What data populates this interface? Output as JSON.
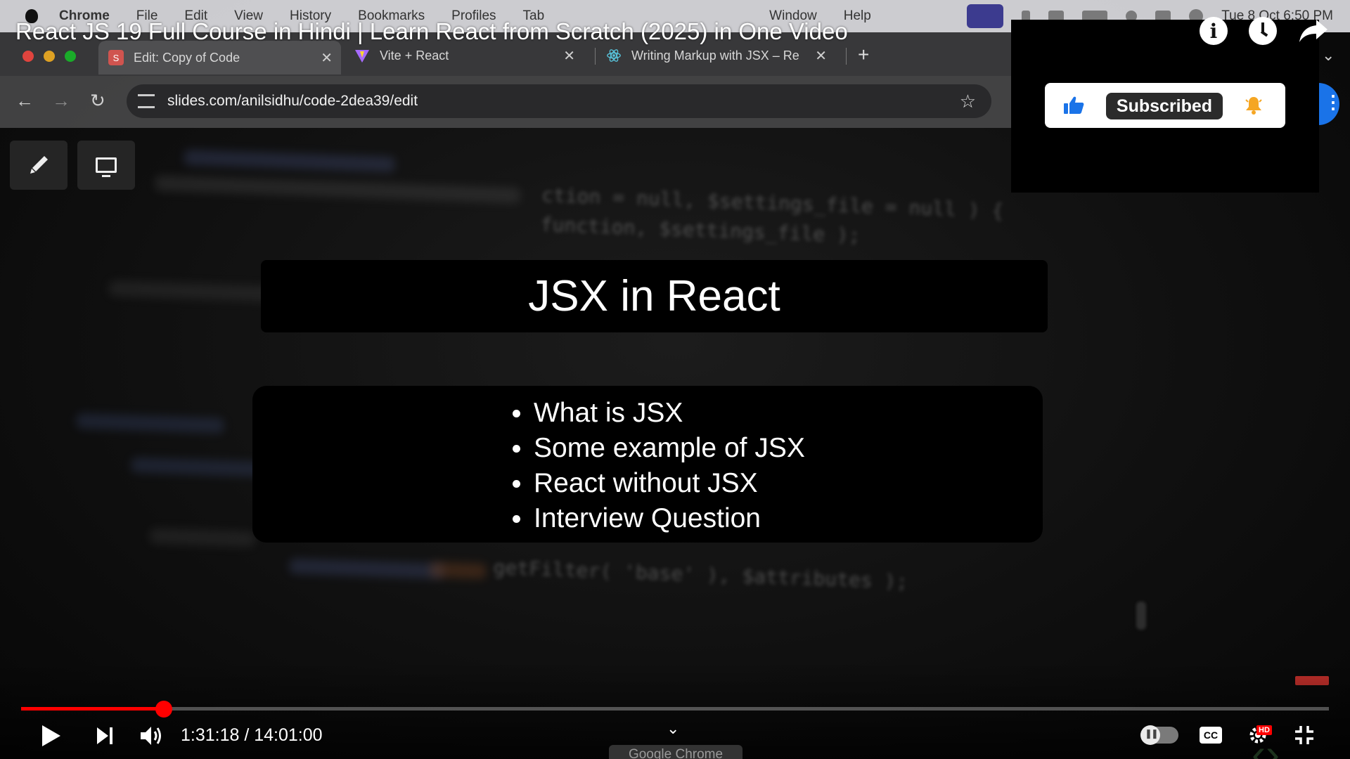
{
  "menubar": {
    "app": "Chrome",
    "items": [
      "File",
      "Edit",
      "View",
      "History",
      "Bookmarks",
      "Profiles",
      "Tab",
      "Window",
      "Help"
    ],
    "clock": "Tue 8 Oct  6:50 PM"
  },
  "video": {
    "title": "React JS 19 Full Course in Hindi | Learn React from Scratch (2025) in One Video",
    "time_current": "1:31:18",
    "time_total": "14:01:00",
    "time_display": "1:31:18 / 14:01:00",
    "progress_fraction": 0.109,
    "subscribe_label": "Subscribed",
    "hd_label": "HD",
    "cc_label": "CC"
  },
  "browser": {
    "tabs": [
      {
        "label": "Edit: Copy of Code",
        "favicon": "S"
      },
      {
        "label": "Vite + React",
        "favicon": "vite-icon"
      },
      {
        "label": "Writing Markup with JSX – Re",
        "favicon": "react-icon"
      }
    ],
    "url": "slides.com/anilsidhu/code-2dea39/edit",
    "taskbar_tooltip": "Google Chrome"
  },
  "slide": {
    "title": "JSX in React",
    "bullets": [
      "What is JSX",
      "Some example of JSX",
      "React without JSX",
      "Interview Question"
    ]
  },
  "background_code": {
    "line1": "ction = null, $settings_file = null ) {",
    "line2": "function, $settings_file );",
    "line3": "getFilter( 'base' ), $attributes );"
  },
  "colors": {
    "progress": "#ff0000",
    "subscribe_button": "#2b2b2b",
    "like_blue": "#1a73e8",
    "bell_orange": "#f5a623"
  }
}
